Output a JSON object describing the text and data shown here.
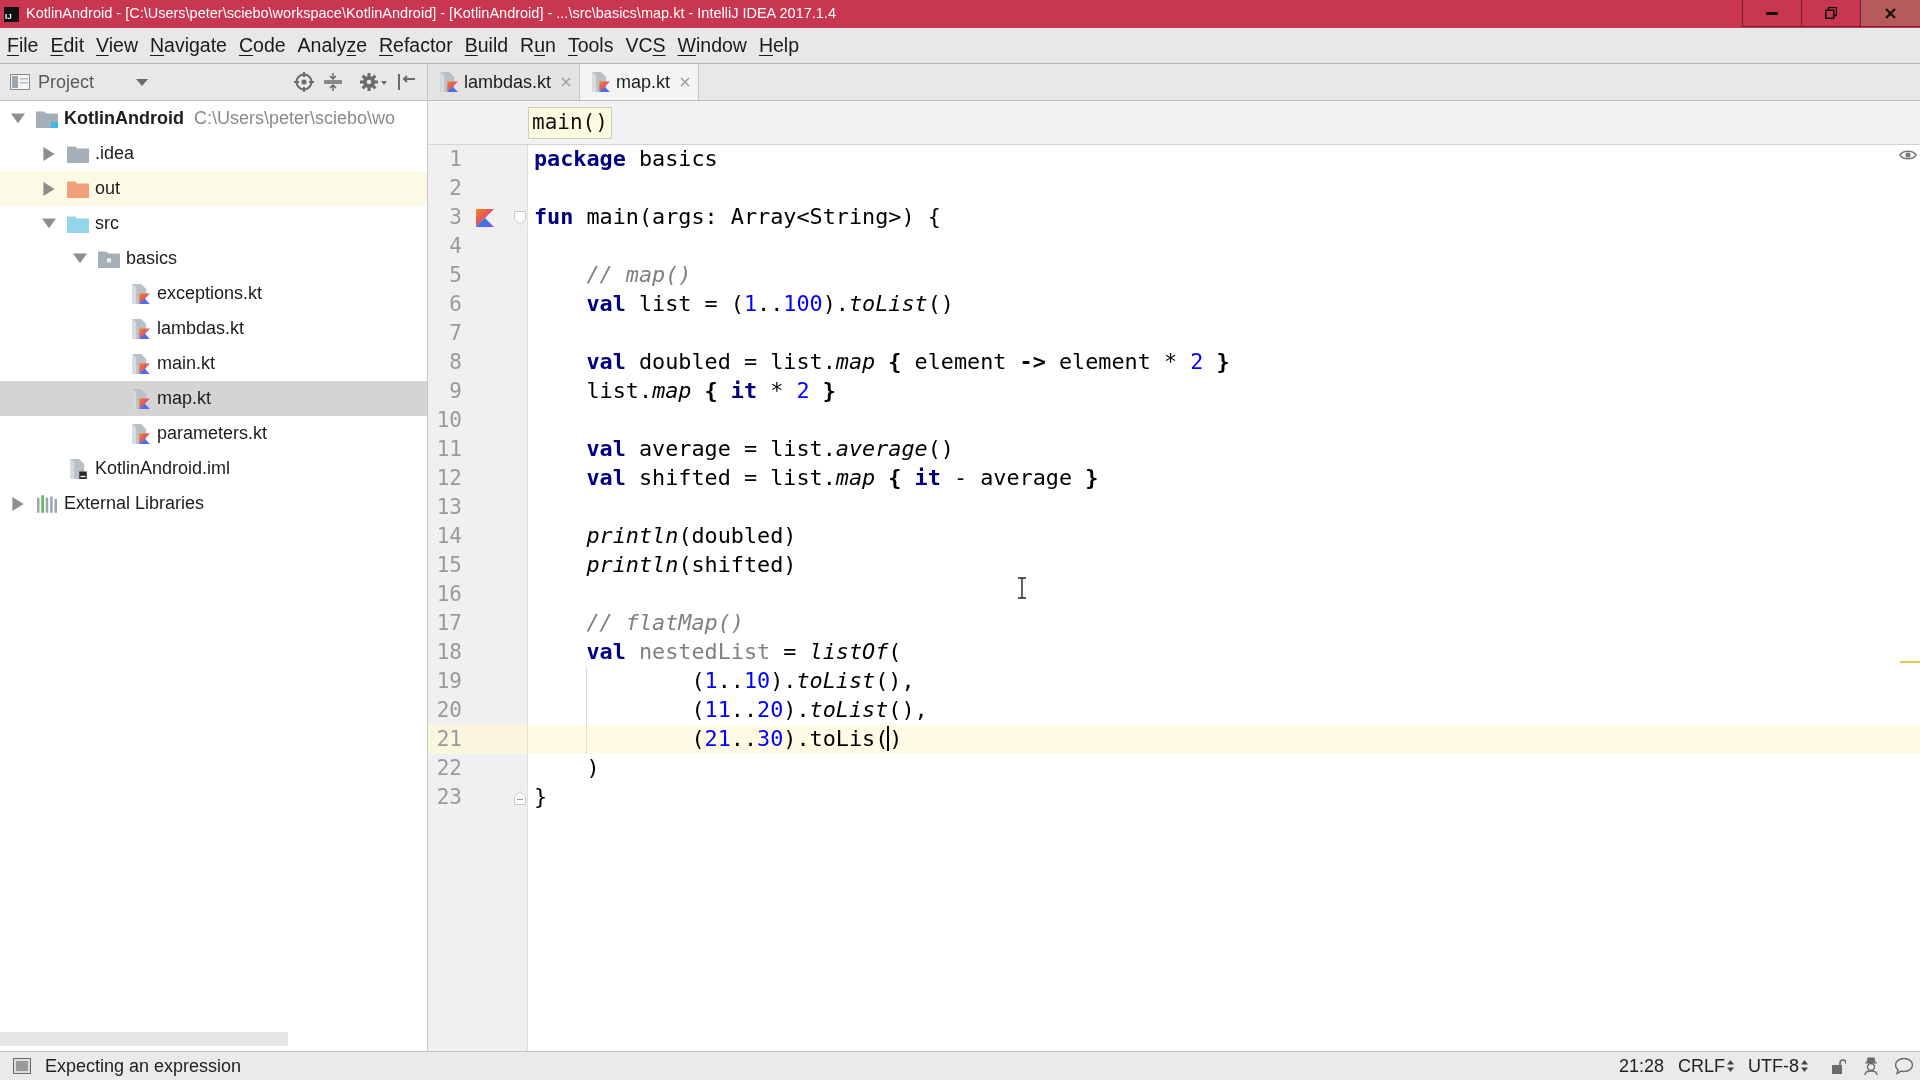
{
  "window": {
    "app_icon_text": "IJ",
    "title": "KotlinAndroid - [C:\\Users\\peter\\sciebo\\workspace\\KotlinAndroid] - [KotlinAndroid] - ...\\src\\basics\\map.kt - IntelliJ IDEA 2017.1.4"
  },
  "menu": [
    {
      "key": "F",
      "post": "ile"
    },
    {
      "key": "E",
      "post": "dit"
    },
    {
      "key": "V",
      "post": "iew"
    },
    {
      "key": "N",
      "post": "avigate"
    },
    {
      "key": "C",
      "post": "ode"
    },
    {
      "pre": "Analy",
      "key": "z",
      "post": "e"
    },
    {
      "key": "R",
      "post": "efactor"
    },
    {
      "key": "B",
      "post": "uild"
    },
    {
      "pre": "R",
      "key": "u",
      "post": "n"
    },
    {
      "key": "T",
      "post": "ools"
    },
    {
      "pre": "VC",
      "key": "S"
    },
    {
      "key": "W",
      "post": "indow"
    },
    {
      "key": "H",
      "post": "elp"
    }
  ],
  "project_panel": {
    "title": "Project",
    "tree": [
      {
        "label": "KotlinAndroid",
        "path": "C:\\Users\\peter\\sciebo\\wo",
        "kind": "module",
        "expanded": true,
        "selected": false,
        "children": [
          {
            "label": ".idea",
            "kind": "folder",
            "expanded": false,
            "selected": false
          },
          {
            "label": "out",
            "kind": "excluded_folder",
            "expanded": false,
            "selected": false
          },
          {
            "label": "src",
            "kind": "source_folder",
            "expanded": true,
            "selected": false,
            "children": [
              {
                "label": "basics",
                "kind": "package",
                "expanded": true,
                "selected": false,
                "children": [
                  {
                    "label": "exceptions.kt",
                    "kind": "kotlin_file",
                    "selected": false
                  },
                  {
                    "label": "lambdas.kt",
                    "kind": "kotlin_file",
                    "selected": false
                  },
                  {
                    "label": "main.kt",
                    "kind": "kotlin_file",
                    "selected": false
                  },
                  {
                    "label": "map.kt",
                    "kind": "kotlin_file",
                    "selected": true
                  },
                  {
                    "label": "parameters.kt",
                    "kind": "kotlin_file",
                    "selected": false
                  }
                ]
              }
            ]
          },
          {
            "label": "KotlinAndroid.iml",
            "kind": "iml_file",
            "selected": false
          }
        ]
      },
      {
        "label": "External Libraries",
        "kind": "libraries",
        "expanded": false,
        "selected": false
      }
    ]
  },
  "tabs": [
    {
      "label": "lambdas.kt",
      "selected": false
    },
    {
      "label": "map.kt",
      "selected": true
    }
  ],
  "editor": {
    "breadcrumb": "main()",
    "lines": [
      {
        "number": "1",
        "current": false,
        "tokens": [
          {
            "text": "package",
            "kind": "keyword"
          },
          {
            "text": " basics",
            "kind": "plain"
          }
        ]
      },
      {
        "number": "2",
        "current": false
      },
      {
        "number": "3",
        "current": false,
        "run_marker": true,
        "fold_start": true,
        "tokens": [
          {
            "text": "fun",
            "kind": "keyword"
          },
          {
            "text": " main(args: Array<String>) {",
            "kind": "plain"
          }
        ]
      },
      {
        "number": "4",
        "current": false
      },
      {
        "number": "5",
        "current": false,
        "tokens": [
          {
            "text": "    // map()",
            "kind": "comment"
          }
        ]
      },
      {
        "number": "6",
        "current": false,
        "tokens": [
          {
            "text": "    val",
            "kind": "keyword"
          },
          {
            "text": " list = (",
            "kind": "plain"
          },
          {
            "text": "1",
            "kind": "number"
          },
          {
            "text": "..",
            "kind": "plain"
          },
          {
            "text": "100",
            "kind": "number"
          },
          {
            "text": ").",
            "kind": "plain"
          },
          {
            "text": "toList",
            "kind": "call"
          },
          {
            "text": "()",
            "kind": "plain"
          }
        ]
      },
      {
        "number": "7",
        "current": false
      },
      {
        "number": "8",
        "current": false,
        "tokens": [
          {
            "text": "    val",
            "kind": "keyword"
          },
          {
            "text": " doubled = list.",
            "kind": "plain"
          },
          {
            "text": "map",
            "kind": "call"
          },
          {
            "text": " {",
            "kind": "bold"
          },
          {
            "text": " element ",
            "kind": "plain"
          },
          {
            "text": "->",
            "kind": "bold"
          },
          {
            "text": " element * ",
            "kind": "plain"
          },
          {
            "text": "2",
            "kind": "number"
          },
          {
            "text": " }",
            "kind": "bold"
          }
        ]
      },
      {
        "number": "9",
        "current": false,
        "tokens": [
          {
            "text": "    list.",
            "kind": "plain"
          },
          {
            "text": "map",
            "kind": "call"
          },
          {
            "text": " {",
            "kind": "bold"
          },
          {
            "text": " it",
            "kind": "keyword"
          },
          {
            "text": " * ",
            "kind": "plain"
          },
          {
            "text": "2",
            "kind": "number"
          },
          {
            "text": " }",
            "kind": "bold"
          }
        ]
      },
      {
        "number": "10",
        "current": false
      },
      {
        "number": "11",
        "current": false,
        "tokens": [
          {
            "text": "    val",
            "kind": "keyword"
          },
          {
            "text": " average = list.",
            "kind": "plain"
          },
          {
            "text": "average",
            "kind": "call"
          },
          {
            "text": "()",
            "kind": "plain"
          }
        ]
      },
      {
        "number": "12",
        "current": false,
        "tokens": [
          {
            "text": "    val",
            "kind": "keyword"
          },
          {
            "text": " shifted = list.",
            "kind": "plain"
          },
          {
            "text": "map",
            "kind": "call"
          },
          {
            "text": " {",
            "kind": "bold"
          },
          {
            "text": " it",
            "kind": "keyword"
          },
          {
            "text": " - average ",
            "kind": "plain"
          },
          {
            "text": "}",
            "kind": "bold"
          }
        ]
      },
      {
        "number": "13",
        "current": false
      },
      {
        "number": "14",
        "current": false,
        "tokens": [
          {
            "text": "    println",
            "kind": "call"
          },
          {
            "text": "(doubled)",
            "kind": "plain"
          }
        ]
      },
      {
        "number": "15",
        "current": false,
        "tokens": [
          {
            "text": "    println",
            "kind": "call"
          },
          {
            "text": "(shifted)",
            "kind": "plain"
          }
        ]
      },
      {
        "number": "16",
        "current": false
      },
      {
        "number": "17",
        "current": false,
        "tokens": [
          {
            "text": "    // flatMap()",
            "kind": "comment"
          }
        ]
      },
      {
        "number": "18",
        "current": false,
        "tokens": [
          {
            "text": "    val",
            "kind": "keyword"
          },
          {
            "text": " nestedList",
            "kind": "unused"
          },
          {
            "text": " = ",
            "kind": "plain"
          },
          {
            "text": "listOf",
            "kind": "call"
          },
          {
            "text": "(",
            "kind": "plain"
          }
        ]
      },
      {
        "number": "19",
        "current": false,
        "indent_guide": true,
        "tokens": [
          {
            "text": "            (",
            "kind": "plain"
          },
          {
            "text": "1",
            "kind": "number"
          },
          {
            "text": "..",
            "kind": "plain"
          },
          {
            "text": "10",
            "kind": "number"
          },
          {
            "text": ").",
            "kind": "plain"
          },
          {
            "text": "toList",
            "kind": "call"
          },
          {
            "text": "(),",
            "kind": "plain"
          }
        ]
      },
      {
        "number": "20",
        "current": false,
        "indent_guide": true,
        "tokens": [
          {
            "text": "            (",
            "kind": "plain"
          },
          {
            "text": "11",
            "kind": "number"
          },
          {
            "text": "..",
            "kind": "plain"
          },
          {
            "text": "20",
            "kind": "number"
          },
          {
            "text": ").",
            "kind": "plain"
          },
          {
            "text": "toList",
            "kind": "call"
          },
          {
            "text": "(),",
            "kind": "plain"
          }
        ]
      },
      {
        "number": "21",
        "current": true,
        "indent_guide": true,
        "tokens": [
          {
            "text": "            (",
            "kind": "plain"
          },
          {
            "text": "21",
            "kind": "number"
          },
          {
            "text": "..",
            "kind": "plain"
          },
          {
            "text": "30",
            "kind": "number"
          },
          {
            "text": ").toLis(",
            "kind": "plain"
          },
          {
            "text": ")",
            "kind": "plain",
            "caret_before": true
          }
        ]
      },
      {
        "number": "22",
        "current": false,
        "tokens": [
          {
            "text": "    )",
            "kind": "plain"
          }
        ]
      },
      {
        "number": "23",
        "current": false,
        "fold_end": true,
        "tokens": [
          {
            "text": "}",
            "kind": "plain"
          }
        ]
      }
    ]
  },
  "status_bar": {
    "message": "Expecting an expression",
    "position": "21:28",
    "line_separator": "CRLF",
    "encoding": "UTF-8"
  }
}
